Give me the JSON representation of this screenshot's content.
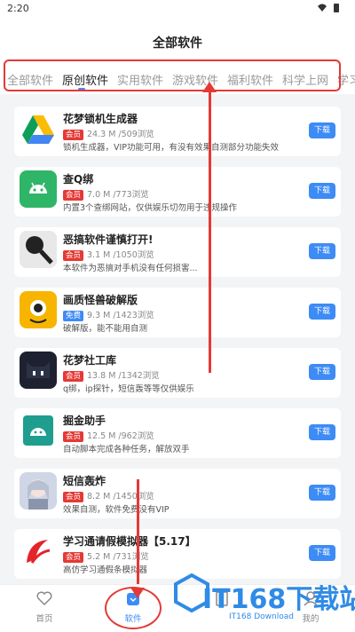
{
  "status": {
    "time": "2:20",
    "icons": "▾ ▮"
  },
  "header": {
    "title": "全部软件"
  },
  "tabs": [
    {
      "label": "全部软件"
    },
    {
      "label": "原创软件"
    },
    {
      "label": "实用软件"
    },
    {
      "label": "游戏软件"
    },
    {
      "label": "福利软件"
    },
    {
      "label": "科学上网"
    },
    {
      "label": "学习"
    }
  ],
  "apps": [
    {
      "name": "花梦锁机生成器",
      "badge": "会员",
      "badge_color": "#e53935",
      "meta": "24.3 M /509浏览",
      "desc": "锁机生成器，VIP功能可用，有没有效果自测部分功能失效",
      "download": "下载",
      "icon": "google-drive-icon"
    },
    {
      "name": "查Q绑",
      "badge": "会员",
      "badge_color": "#e53935",
      "meta": "7.0 M /773浏览",
      "desc": "内置3个查绑网站，仅供娱乐切勿用于违规操作",
      "download": "下载",
      "icon": "android-icon"
    },
    {
      "name": "恶搞软件谨慎打开!",
      "badge": "会员",
      "badge_color": "#e53935",
      "meta": "3.1 M /1050浏览",
      "desc": "本软件为恶搞对手机没有任何损害...",
      "download": "下载",
      "icon": "magnifier-icon"
    },
    {
      "name": "画质怪兽破解版",
      "badge": "免费",
      "badge_color": "#3d8bf5",
      "meta": "9.3 M /1423浏览",
      "desc": "破解版，能不能用自测",
      "download": "下载",
      "icon": "monster-icon"
    },
    {
      "name": "花梦社工库",
      "badge": "会员",
      "badge_color": "#e53935",
      "meta": "13.8 M /1342浏览",
      "desc": "q绑，ip探针，短信轰等等仅供娱乐",
      "download": "下载",
      "icon": "cat-icon"
    },
    {
      "name": "掘金助手",
      "badge": "会员",
      "badge_color": "#e53935",
      "meta": "12.5 M /962浏览",
      "desc": "自动脚本完成各种任务，解放双手",
      "download": "下载",
      "icon": "android-teal-icon"
    },
    {
      "name": "短信轰炸",
      "badge": "会员",
      "badge_color": "#e53935",
      "meta": "8.2 M /1450浏览",
      "desc": "效果自测，软件免费没有VIP",
      "download": "下载",
      "icon": "anime-avatar-icon"
    },
    {
      "name": "学习通请假模拟器【5.17】",
      "badge": "会员",
      "badge_color": "#e53935",
      "meta": "5.2 M /731浏览",
      "desc": "高仿学习通假条模拟器",
      "download": "下载",
      "icon": "xuexitong-icon"
    }
  ],
  "nav": [
    {
      "label": "首页",
      "icon": "heart-icon"
    },
    {
      "label": "软件",
      "icon": "bag-icon"
    },
    {
      "label": "",
      "icon": "book-icon"
    },
    {
      "label": "我的",
      "icon": "user-icon"
    }
  ],
  "watermark": {
    "text": "IT168下载站",
    "sub": "IT168 Download"
  },
  "colors": {
    "accent": "#3d8bf5",
    "annotation": "#e53935",
    "member_badge": "#e53935",
    "free_badge": "#3d8bf5"
  }
}
